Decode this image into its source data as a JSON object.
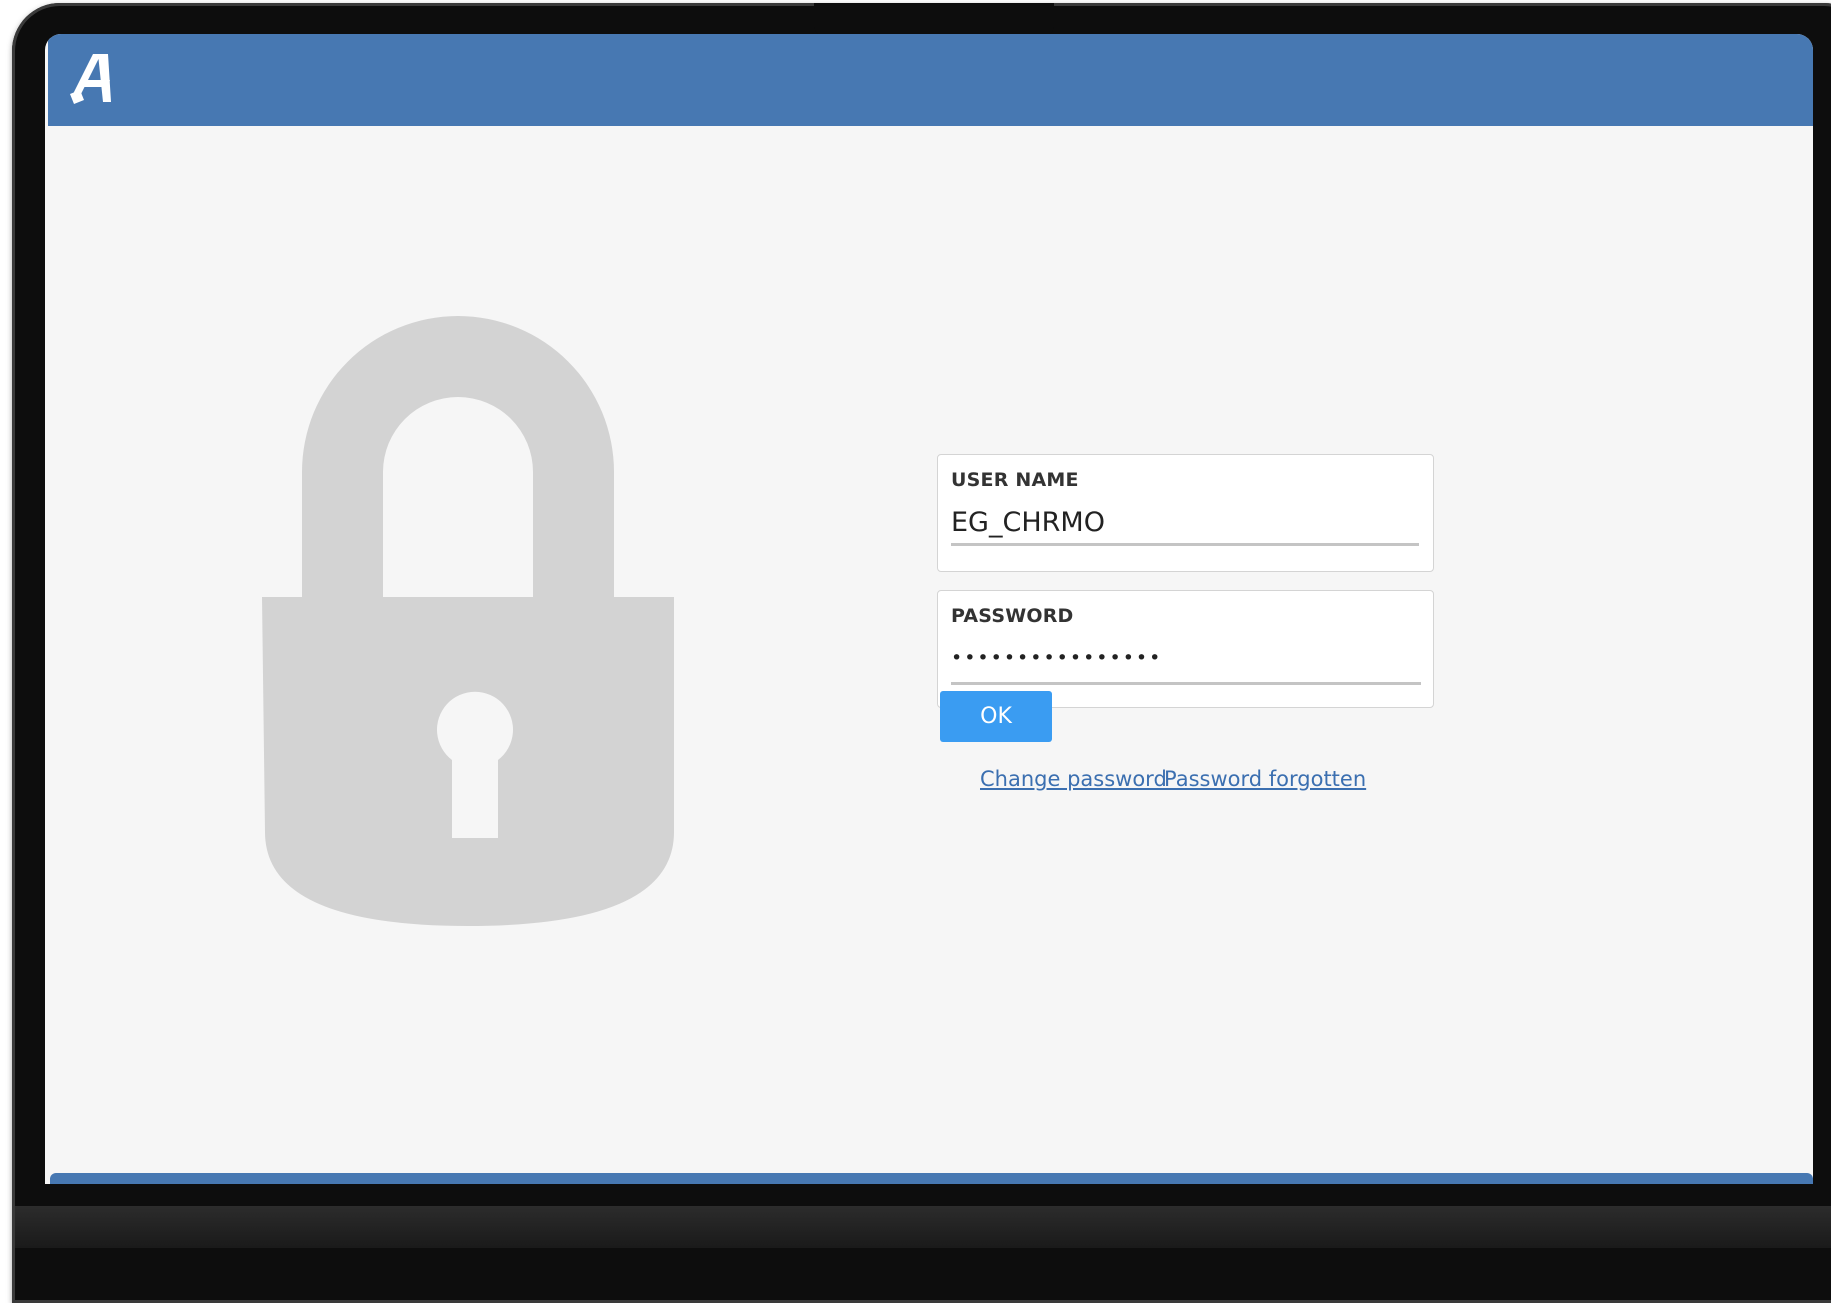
{
  "header": {
    "logo_icon": "app-logo-a",
    "bar_color": "#4778b2"
  },
  "lock_icon": "padlock-icon",
  "login": {
    "username_label": "USER NAME",
    "username_value": "EG_CHRMO",
    "password_label": "PASSWORD",
    "password_masked": "••••••••••••••••",
    "ok_label": "OK",
    "change_password_label": "Change password",
    "password_forgotten_label": "Password forgotten"
  },
  "colors": {
    "accent": "#3a9cf2",
    "link": "#3b6fb0",
    "background": "#f6f6f6"
  }
}
